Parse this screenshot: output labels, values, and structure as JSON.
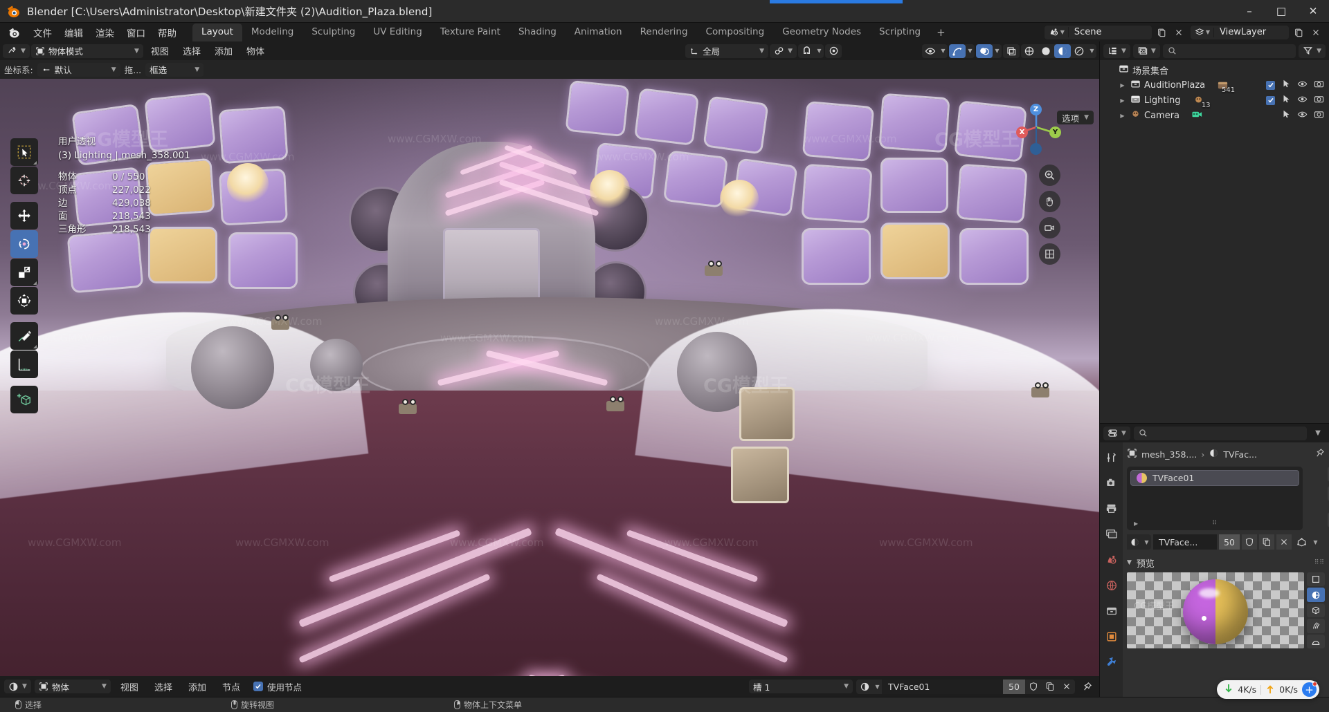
{
  "window": {
    "title": "Blender [C:\\Users\\Administrator\\Desktop\\新建文件夹 (2)\\Audition_Plaza.blend]",
    "minimize": "–",
    "maximize": "□",
    "close": "✕"
  },
  "topbar": {
    "menus": [
      "文件",
      "编辑",
      "渲染",
      "窗口",
      "帮助"
    ],
    "tabs": [
      "Layout",
      "Modeling",
      "Sculpting",
      "UV Editing",
      "Texture Paint",
      "Shading",
      "Animation",
      "Rendering",
      "Compositing",
      "Geometry Nodes",
      "Scripting"
    ],
    "active_tab": "Layout",
    "add_tab": "+",
    "scene_name": "Scene",
    "view_layer_name": "ViewLayer"
  },
  "viewport_header": {
    "mode": "物体模式",
    "menus": [
      "视图",
      "选择",
      "添加",
      "物体"
    ],
    "transform_orientation": "全局",
    "options_label": "选项"
  },
  "viewport_header2": {
    "coord_label": "坐标系:",
    "coord_value": "默认",
    "drag_label": "拖...",
    "select_mode": "框选"
  },
  "viewport_stats": {
    "view_name": "用户透视",
    "active_object": "(3) Lighting | mesh_358.001",
    "rows": [
      {
        "key": "物体",
        "value": "0 / 550"
      },
      {
        "key": "顶点",
        "value": "227,022"
      },
      {
        "key": "边",
        "value": "429,038"
      },
      {
        "key": "面",
        "value": "218,543"
      },
      {
        "key": "三角形",
        "value": "218,543"
      }
    ]
  },
  "toolbar": {
    "tools": [
      {
        "name": "tweak-tool",
        "label": "选择框"
      },
      {
        "name": "cursor-tool",
        "label": "游标"
      },
      {
        "name": "move-tool",
        "label": "移动"
      },
      {
        "name": "rotate-tool",
        "label": "旋转"
      },
      {
        "name": "scale-tool",
        "label": "缩放"
      },
      {
        "name": "transform-tool",
        "label": "变换"
      },
      {
        "name": "annotate-tool",
        "label": "标注"
      },
      {
        "name": "measure-tool",
        "label": "测量"
      },
      {
        "name": "add-cube-tool",
        "label": "添加立方体"
      }
    ],
    "active_tool": "rotate-tool"
  },
  "gizmo": {
    "axes": [
      "Z",
      "Y",
      "X"
    ],
    "colors": {
      "x": "#e05b5b",
      "y": "#9dcc4b",
      "z": "#4e8fdd"
    }
  },
  "outliner": {
    "search_placeholder": "",
    "rows": [
      {
        "label": "场景集合",
        "indent": 0,
        "badge": "",
        "has_checkbox": false,
        "icon": "collection-icon",
        "expandable": false
      },
      {
        "label": "AuditionPlaza",
        "indent": 1,
        "badge": "541",
        "has_checkbox": true,
        "icon": "collection-icon",
        "expandable": true
      },
      {
        "label": "Lighting",
        "indent": 1,
        "badge": "13",
        "has_checkbox": true,
        "icon": "collection-icon",
        "expandable": true
      },
      {
        "label": "Camera",
        "indent": 1,
        "badge": "",
        "has_checkbox": false,
        "icon": "camera-icon",
        "expandable": true
      }
    ]
  },
  "properties": {
    "search_placeholder": "",
    "breadcrumb": [
      "mesh_358....",
      "TVFac..."
    ],
    "material_slots": [
      {
        "name": "TVFace01"
      }
    ],
    "material_name": "TVFace...",
    "material_users": "50",
    "side_buttons": [
      "+",
      "–",
      "⌄"
    ],
    "preview_title": "预览",
    "preview_shapes": [
      "flat",
      "sphere",
      "cube",
      "hair",
      "shaderball"
    ],
    "active_preview_shape": "sphere",
    "tabs": [
      "tool-properties-tab",
      "render-properties-tab",
      "output-properties-tab",
      "view-layer-properties-tab",
      "scene-properties-tab",
      "world-properties-tab",
      "collection-properties-tab",
      "object-properties-tab",
      "modifier-properties-tab"
    ],
    "active_tab": "material-properties-tab"
  },
  "shader_editor": {
    "shader_type": "物体",
    "menus": [
      "视图",
      "选择",
      "添加",
      "节点"
    ],
    "use_nodes_label": "使用节点",
    "use_nodes_checked": true,
    "slot_label": "槽 1",
    "material_name": "TVFace01",
    "material_users": "50"
  },
  "statusbar": {
    "hints": [
      {
        "button": "l",
        "label": "选择"
      },
      {
        "button": "m",
        "label": "旋转视图"
      },
      {
        "button": "r",
        "label": "物体上下文菜单"
      }
    ]
  },
  "net_widget": {
    "download": "4K/s",
    "upload": "0K/s",
    "plus": "+"
  },
  "watermarks": {
    "small": "www.CGMXW.com",
    "big": "CG模型王"
  },
  "colors": {
    "accent_blue": "#4772b3",
    "panel_bg": "#303030",
    "editor_bg": "#282828",
    "header_bg": "#1d1d1d",
    "text": "#d6d6d6"
  }
}
